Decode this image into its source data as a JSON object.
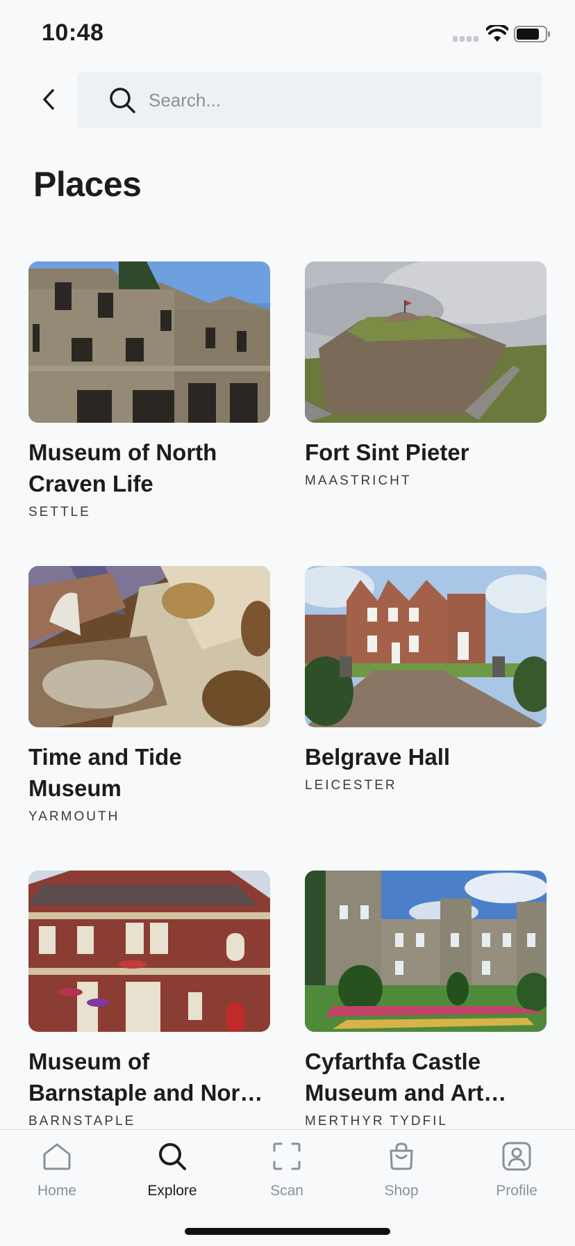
{
  "status_bar": {
    "time": "10:48"
  },
  "search": {
    "placeholder": "Search..."
  },
  "page": {
    "title": "Places"
  },
  "places": [
    {
      "name": "Museum of North Craven Life",
      "city": "SETTLE"
    },
    {
      "name": "Fort Sint Pieter",
      "city": "MAASTRICHT"
    },
    {
      "name": "Time and Tide Museum",
      "city": "YARMOUTH"
    },
    {
      "name": "Belgrave Hall",
      "city": "LEICESTER"
    },
    {
      "name": "Museum of Barnstaple and North Devon",
      "city": "BARNSTAPLE"
    },
    {
      "name": "Cyfarthfa Castle Museum and Art Gallery",
      "city": "MERTHYR TYDFIL"
    }
  ],
  "tab_bar": {
    "tabs": [
      {
        "label": "Home",
        "icon": "home-icon"
      },
      {
        "label": "Explore",
        "icon": "search-icon",
        "active": true
      },
      {
        "label": "Scan",
        "icon": "scan-icon"
      },
      {
        "label": "Shop",
        "icon": "bag-icon"
      },
      {
        "label": "Profile",
        "icon": "profile-icon"
      }
    ]
  }
}
